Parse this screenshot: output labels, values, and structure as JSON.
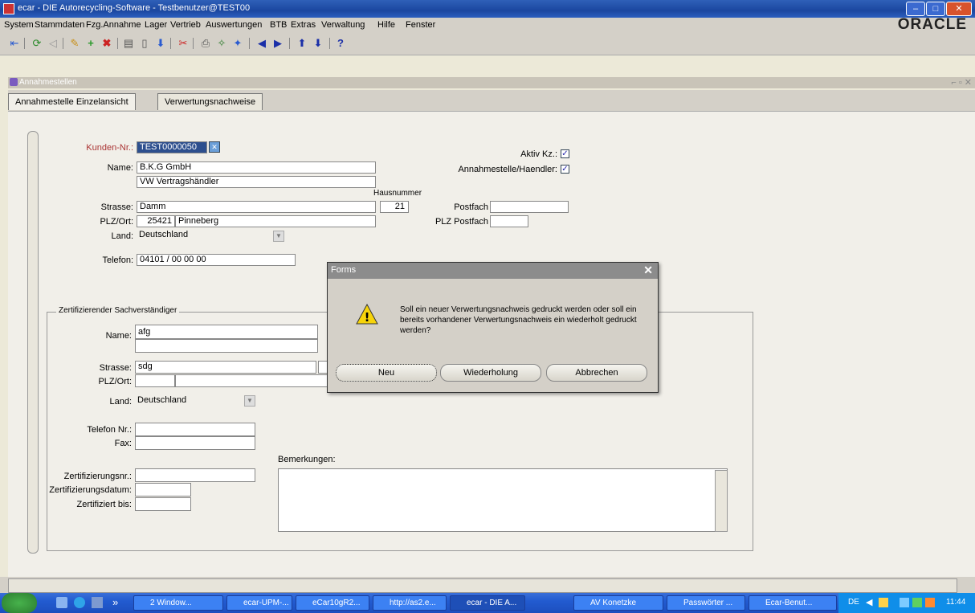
{
  "window": {
    "title": "ecar - DIE Autorecycling-Software - Testbenutzer@TEST00",
    "min_label": "–",
    "max_label": "□",
    "close_label": "✕"
  },
  "menubar": {
    "items": [
      "System",
      "Stammdaten",
      "Fzg.Annahme",
      "Lager",
      "Vertrieb",
      "Auswertungen",
      "BTB",
      "Extras",
      "Verwaltung",
      "Hilfe",
      "Fenster"
    ],
    "brand": "ORACLE"
  },
  "toolbar": {
    "icons": [
      "first-record-icon",
      "refresh-icon",
      "back-icon",
      "edit-icon",
      "add-icon",
      "delete-icon",
      "print-icon",
      "list-icon",
      "down-icon",
      "insert-icon",
      "print2-icon",
      "tools-icon",
      "wand-icon",
      "prev-icon",
      "next-icon",
      "up-icon",
      "down2-icon",
      "help-icon"
    ],
    "help_label": "?"
  },
  "inner_window": {
    "title": "Annahmestellen"
  },
  "tabs": [
    {
      "label": "Annahmestelle Einzelansicht",
      "active": true
    },
    {
      "label": "Verwertungsnachweise",
      "active": false
    }
  ],
  "form": {
    "kunden_nr": {
      "label": "Kunden-Nr.:",
      "value": "TEST0000050"
    },
    "name": {
      "label": "Name:",
      "value1": "B.K.G GmbH",
      "value2": "VW Vertragshändler"
    },
    "hausnummer": {
      "label": "Hausnummer",
      "value": "21"
    },
    "strasse": {
      "label": "Strasse:",
      "value": "Damm"
    },
    "plz_ort": {
      "label": "PLZ/Ort:",
      "plz": "25421",
      "ort": "Pinneberg"
    },
    "land": {
      "label": "Land:",
      "value": "Deutschland"
    },
    "telefon": {
      "label": "Telefon:",
      "value": "04101 / 00 00 00"
    },
    "aktiv": {
      "label": "Aktiv Kz.:",
      "checked": true
    },
    "annahmestelle": {
      "label": "Annahmestelle/Haendler:",
      "checked": true
    },
    "postfach": {
      "label": "Postfach",
      "value": ""
    },
    "plz_postfach": {
      "label": "PLZ Postfach",
      "value": ""
    }
  },
  "zertifizierer": {
    "group_label": "Zertifizierender Sachverständiger",
    "name": {
      "label": "Name:",
      "value1": "afg",
      "value2": ""
    },
    "strasse": {
      "label": "Strasse:",
      "value": "sdg"
    },
    "plz_ort": {
      "label": "PLZ/Ort:",
      "plz": "",
      "ort": ""
    },
    "land": {
      "label": "Land:",
      "value": "Deutschland"
    },
    "telefon": {
      "label": "Telefon Nr.:",
      "value": ""
    },
    "fax": {
      "label": "Fax:",
      "value": ""
    },
    "zertifizierungsnr": {
      "label": "Zertifizierungsnr.:",
      "value": ""
    },
    "zertifizierungsdatum": {
      "label": "Zertifizierungsdatum:",
      "value": ""
    },
    "zertifiziert_bis": {
      "label": "Zertifiziert bis:",
      "value": ""
    },
    "bemerkungen": {
      "label": "Bemerkungen:",
      "value": ""
    }
  },
  "dialog": {
    "title": "Forms",
    "close_label": "✕",
    "message": "Soll ein neuer Verwertungsnachweis gedruckt werden oder soll ein bereits vorhandener Verwertungsnachweis ein wiederholt gedruckt werden?",
    "buttons": [
      "Neu",
      "Wiederholung",
      "Abbrechen"
    ],
    "warning_glyph": "!"
  },
  "taskbar": {
    "tasks": [
      "2 Window...",
      "ecar-UPM-...",
      "eCar10gR2...",
      "http://as2.e...",
      "ecar - DIE A...",
      "AV Konetzke",
      "Passwörter ...",
      "Ecar-Benut..."
    ],
    "chevron": "»",
    "language": "DE",
    "clock": "11:44"
  }
}
